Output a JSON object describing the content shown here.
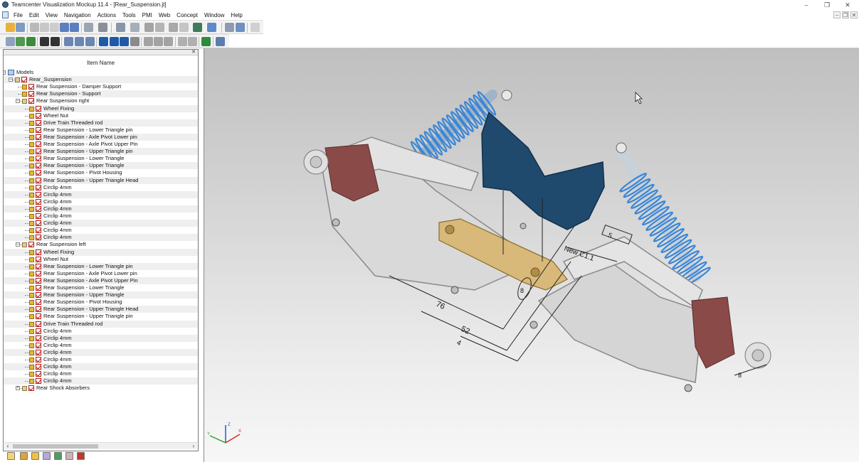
{
  "window": {
    "title": "Teamcenter Visualization Mockup 11.4 - [Rear_Suspension.jt]",
    "controls": {
      "minimize": "–",
      "restore": "❐",
      "close": "✕"
    }
  },
  "menu": [
    "File",
    "Edit",
    "View",
    "Navigation",
    "Actions",
    "Tools",
    "PMI",
    "Web",
    "Concept",
    "Window",
    "Help"
  ],
  "panel": {
    "column_header": "Item Name"
  },
  "tree": [
    {
      "label": "Models",
      "level": 0,
      "kind": "models",
      "expander": "–"
    },
    {
      "label": "Rear_Suspension",
      "level": 1,
      "kind": "assembly",
      "expander": "–"
    },
    {
      "label": "Rear Suspension - Damper Support",
      "level": 2,
      "kind": "part"
    },
    {
      "label": "Rear Suspension - Support",
      "level": 2,
      "kind": "part"
    },
    {
      "label": "Rear Suspension right",
      "level": 2,
      "kind": "assembly",
      "expander": "–"
    },
    {
      "label": "Wheel Fixing",
      "level": 3,
      "kind": "part"
    },
    {
      "label": "Wheel Nut",
      "level": 3,
      "kind": "part"
    },
    {
      "label": "Drive Train Threaded rod",
      "level": 3,
      "kind": "part"
    },
    {
      "label": "Rear Suspension - Lower Triangle pin",
      "level": 3,
      "kind": "part"
    },
    {
      "label": "Rear Suspension - Axle Pivot Lower pin",
      "level": 3,
      "kind": "part"
    },
    {
      "label": "Rear Suspension - Axle Pivot Upper Pin",
      "level": 3,
      "kind": "part"
    },
    {
      "label": "Rear Suspension - Upper Triangle pin",
      "level": 3,
      "kind": "part"
    },
    {
      "label": "Rear Suspension - Lower Triangle",
      "level": 3,
      "kind": "part"
    },
    {
      "label": "Rear Suspension - Upper Triangle",
      "level": 3,
      "kind": "part"
    },
    {
      "label": "Rear Suspension - Pivot Housing",
      "level": 3,
      "kind": "part"
    },
    {
      "label": "Rear Suspension - Upper Triangle Head",
      "level": 3,
      "kind": "part"
    },
    {
      "label": "Circlip 4mm",
      "level": 3,
      "kind": "part"
    },
    {
      "label": "Circlip 4mm",
      "level": 3,
      "kind": "part"
    },
    {
      "label": "Circlip 4mm",
      "level": 3,
      "kind": "part"
    },
    {
      "label": "Circlip 4mm",
      "level": 3,
      "kind": "part"
    },
    {
      "label": "Circlip 4mm",
      "level": 3,
      "kind": "part"
    },
    {
      "label": "Circlip 4mm",
      "level": 3,
      "kind": "part"
    },
    {
      "label": "Circlip 4mm",
      "level": 3,
      "kind": "part"
    },
    {
      "label": "Circlip 4mm",
      "level": 3,
      "kind": "part"
    },
    {
      "label": "Rear Suspension left",
      "level": 2,
      "kind": "assembly",
      "expander": "–"
    },
    {
      "label": "Wheel Fixing",
      "level": 3,
      "kind": "part"
    },
    {
      "label": "Wheel Nut",
      "level": 3,
      "kind": "part"
    },
    {
      "label": "Rear Suspension - Lower Triangle pin",
      "level": 3,
      "kind": "part"
    },
    {
      "label": "Rear Suspension - Axle Pivot Lower pin",
      "level": 3,
      "kind": "part"
    },
    {
      "label": "Rear Suspension - Axle Pivot Upper Pin",
      "level": 3,
      "kind": "part"
    },
    {
      "label": "Rear Suspension - Lower Triangle",
      "level": 3,
      "kind": "part"
    },
    {
      "label": "Rear Suspension - Upper Triangle",
      "level": 3,
      "kind": "part"
    },
    {
      "label": "Rear Suspension - Pivot Housing",
      "level": 3,
      "kind": "part"
    },
    {
      "label": "Rear Suspension - Upper Triangle Head",
      "level": 3,
      "kind": "part"
    },
    {
      "label": "Rear Suspension - Upper Triangle pin",
      "level": 3,
      "kind": "part"
    },
    {
      "label": "Drive Train Threaded rod",
      "level": 3,
      "kind": "part"
    },
    {
      "label": "Circlip 4mm",
      "level": 3,
      "kind": "part"
    },
    {
      "label": "Circlip 4mm",
      "level": 3,
      "kind": "part"
    },
    {
      "label": "Circlip 4mm",
      "level": 3,
      "kind": "part"
    },
    {
      "label": "Circlip 4mm",
      "level": 3,
      "kind": "part"
    },
    {
      "label": "Circlip 4mm",
      "level": 3,
      "kind": "part"
    },
    {
      "label": "Circlip 4mm",
      "level": 3,
      "kind": "part"
    },
    {
      "label": "Circlip 4mm",
      "level": 3,
      "kind": "part"
    },
    {
      "label": "Circlip 4mm",
      "level": 3,
      "kind": "part"
    },
    {
      "label": "Rear Shock Absorbers",
      "level": 2,
      "kind": "assembly",
      "expander": "+"
    }
  ],
  "viewport": {
    "dimensions": [
      "76",
      "52",
      "4",
      "8",
      "8"
    ],
    "pmi_label": "New C1.1",
    "frame_label": "5",
    "axis_labels": {
      "x": "X",
      "y": "Y",
      "z": "Z"
    },
    "colors": {
      "frame": "#d4d4d4",
      "spring": "#3a86d6",
      "plate": "#1f4a6e",
      "housing": "#8a4a48",
      "link": "#d9b97a"
    }
  }
}
